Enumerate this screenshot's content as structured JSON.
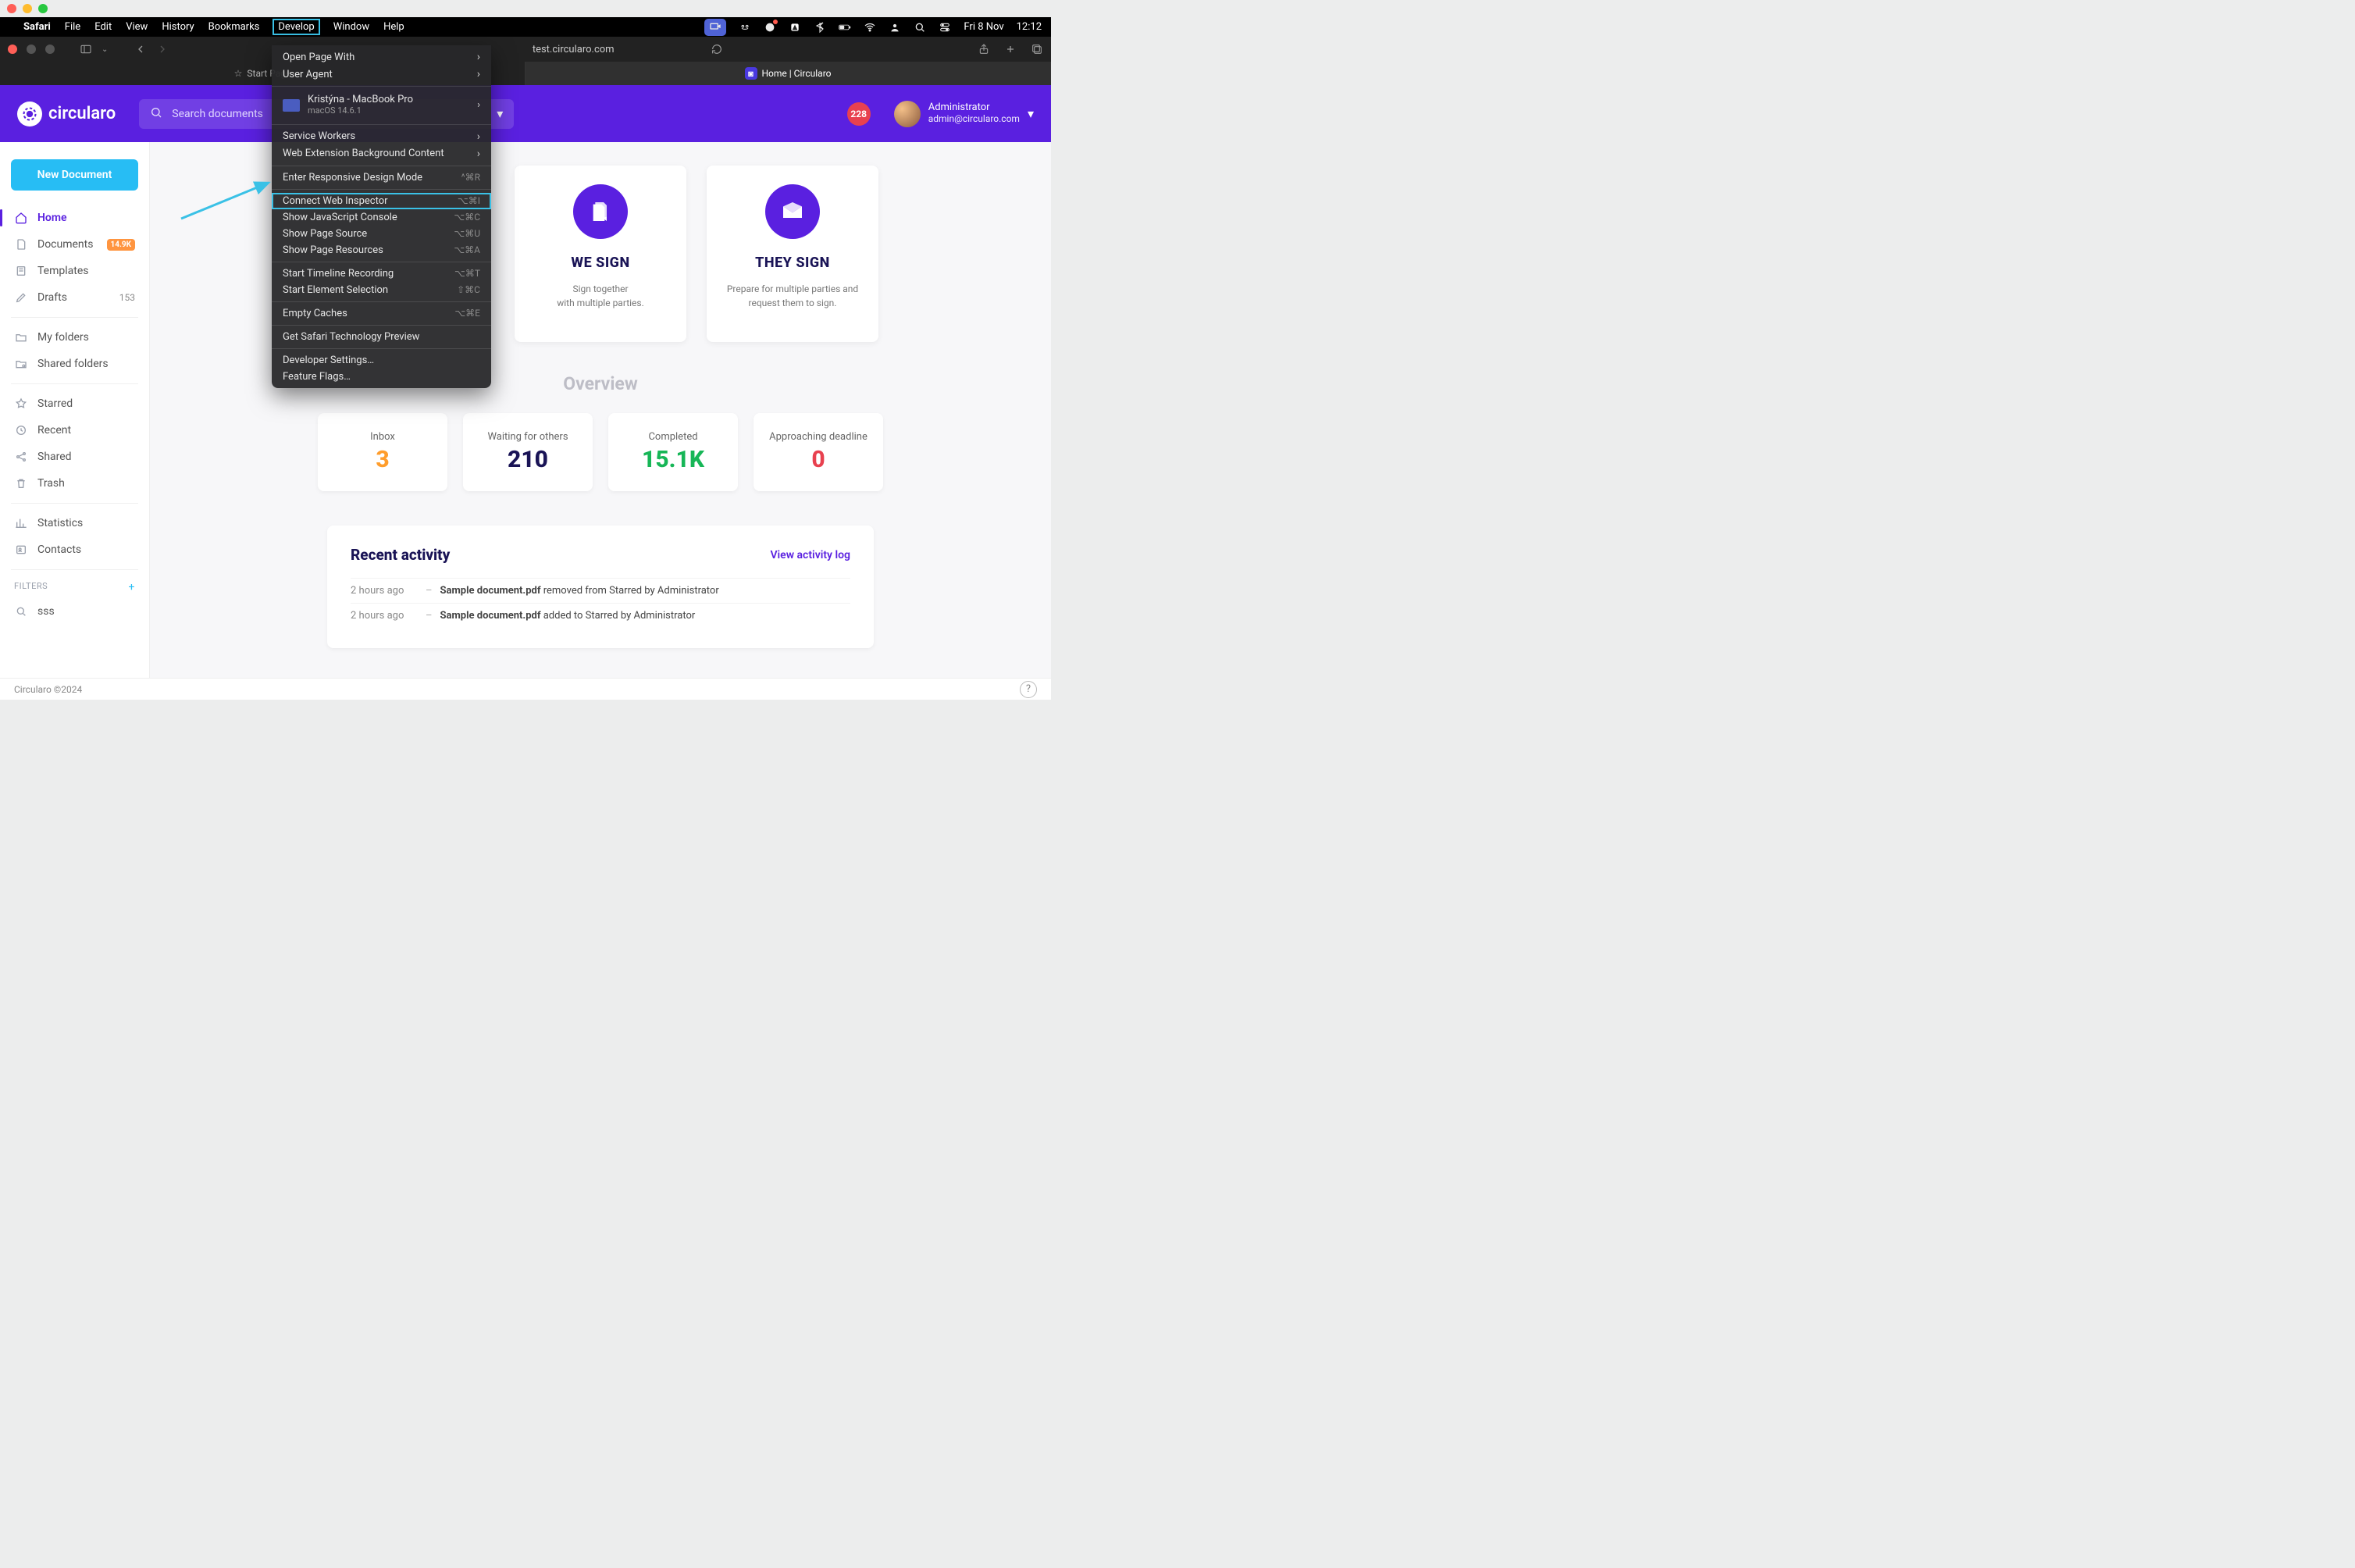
{
  "menubar": {
    "app": "Safari",
    "items": [
      "File",
      "Edit",
      "View",
      "History",
      "Bookmarks",
      "Develop",
      "Window",
      "Help"
    ],
    "active": "Develop",
    "status": {
      "date": "Fri 8 Nov",
      "time": "12:12"
    }
  },
  "safari": {
    "address": "test.circularo.com",
    "tabs": [
      {
        "label": "Start Page",
        "active": false
      },
      {
        "label": "Home | Circularo",
        "active": true
      }
    ]
  },
  "develop_menu": {
    "open_page_with": "Open Page With",
    "user_agent": "User Agent",
    "device_name": "Kristýna - MacBook Pro",
    "device_sub": "macOS 14.6.1",
    "service_workers": "Service Workers",
    "web_ext": "Web Extension Background Content",
    "responsive": "Enter Responsive Design Mode",
    "responsive_sc": "^⌘R",
    "connect_inspector": "Connect Web Inspector",
    "connect_sc": "⌥⌘I",
    "js_console": "Show JavaScript Console",
    "js_sc": "⌥⌘C",
    "page_source": "Show Page Source",
    "ps_sc": "⌥⌘U",
    "page_resources": "Show Page Resources",
    "pr_sc": "⌥⌘A",
    "timeline": "Start Timeline Recording",
    "tl_sc": "⌥⌘T",
    "element_sel": "Start Element Selection",
    "es_sc": "⇧⌘C",
    "empty_caches": "Empty Caches",
    "ec_sc": "⌥⌘E",
    "tech_preview": "Get Safari Technology Preview",
    "dev_settings": "Developer Settings…",
    "feature_flags": "Feature Flags…"
  },
  "app": {
    "brand": "circularo",
    "search_placeholder": "Search documents",
    "notif_count": "228",
    "user_name": "Administrator",
    "user_email": "admin@circularo.com"
  },
  "sidebar": {
    "new_document": "New Document",
    "items": [
      {
        "label": "Home",
        "active": true
      },
      {
        "label": "Documents",
        "badge": "14.9K"
      },
      {
        "label": "Templates"
      },
      {
        "label": "Drafts",
        "count": "153"
      }
    ],
    "group2": [
      {
        "label": "My folders"
      },
      {
        "label": "Shared folders"
      }
    ],
    "group3": [
      {
        "label": "Starred"
      },
      {
        "label": "Recent"
      },
      {
        "label": "Shared"
      },
      {
        "label": "Trash"
      }
    ],
    "group4": [
      {
        "label": "Statistics"
      },
      {
        "label": "Contacts"
      }
    ],
    "filters_head": "FILTERS",
    "filters": [
      {
        "label": "sss"
      }
    ]
  },
  "cards": [
    {
      "title": "",
      "desc": ""
    },
    {
      "title": "WE SIGN",
      "desc1": "Sign together",
      "desc2": "with multiple parties."
    },
    {
      "title": "THEY SIGN",
      "desc1": "Prepare for multiple parties and",
      "desc2": "request them to sign."
    }
  ],
  "overview": {
    "title": "Overview",
    "stats": [
      {
        "label": "Inbox",
        "value": "3",
        "color": "#ff9d2c"
      },
      {
        "label": "Waiting for others",
        "value": "210",
        "color": "#1a1456"
      },
      {
        "label": "Completed",
        "value": "15.1K",
        "color": "#17b657"
      },
      {
        "label": "Approaching deadline",
        "value": "0",
        "color": "#e8414f"
      }
    ]
  },
  "activity": {
    "title": "Recent activity",
    "link": "View activity log",
    "rows": [
      {
        "time": "2 hours ago",
        "doc": "Sample document.pdf",
        "rest": " removed from Starred by Administrator"
      },
      {
        "time": "2 hours ago",
        "doc": "Sample document.pdf",
        "rest": " added to Starred by Administrator"
      }
    ]
  },
  "footer": {
    "copyright": "Circularo ©2024"
  }
}
